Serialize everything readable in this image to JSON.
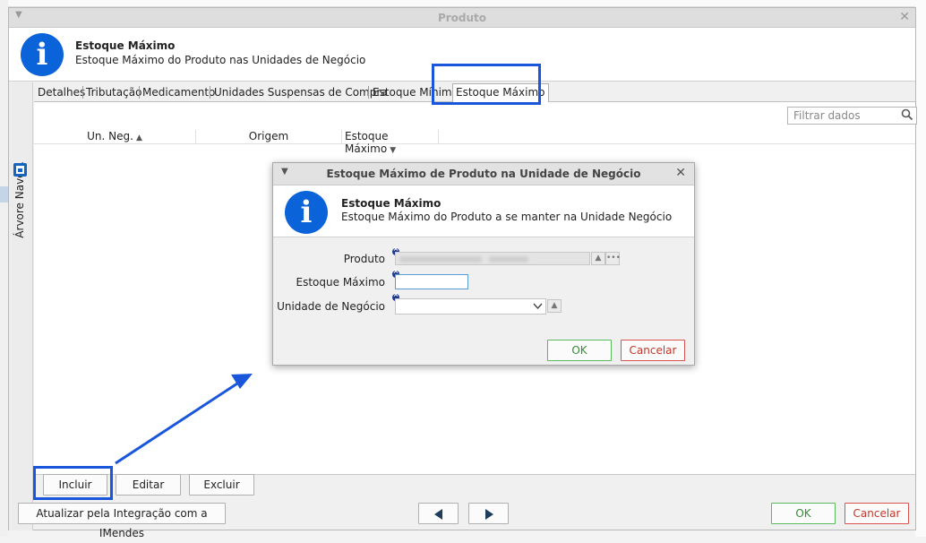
{
  "window": {
    "title": "Produto",
    "header_title": "Estoque Máximo",
    "header_subtitle": "Estoque Máximo do Produto nas Unidades de Negócio"
  },
  "sidebar": {
    "label": "Árvore Naveg."
  },
  "tabs": [
    {
      "label": "Detalhes"
    },
    {
      "label": "Tributação"
    },
    {
      "label": "Medicamento"
    },
    {
      "label": "Unidades Suspensas de Compra"
    },
    {
      "label": "Estoque Mínimo"
    },
    {
      "label": "Estoque Máximo",
      "active": true
    }
  ],
  "filter": {
    "placeholder": "Filtrar dados"
  },
  "table": {
    "columns": [
      {
        "label": "Un. Neg.",
        "sort": "▲"
      },
      {
        "label": "Origem",
        "sort": ""
      },
      {
        "label": "Estoque Máximo",
        "sort": "▼"
      }
    ],
    "rows": []
  },
  "actions": {
    "incluir": "Incluir",
    "editar": "Editar",
    "excluir": "Excluir"
  },
  "footer": {
    "integrate": "Atualizar pela Integração com a IMendes",
    "ok": "OK",
    "cancel": "Cancelar"
  },
  "dialog": {
    "title": "Estoque Máximo de Produto na Unidade de Negócio",
    "header_title": "Estoque Máximo",
    "header_subtitle": "Estoque Máximo do Produto a se manter na Unidade Negócio",
    "fields": {
      "produto_label": "Produto",
      "estoque_label": "Estoque Máximo",
      "estoque_value": "",
      "unidade_label": "Unidade de Negócio",
      "unidade_value": ""
    },
    "ok": "OK",
    "cancel": "Cancelar"
  },
  "colors": {
    "accent": "#0b63d9",
    "highlight": "#1a56db",
    "ok": "#5cb85c",
    "cancel": "#d9534f"
  },
  "icons": {
    "info": "info-icon",
    "search": "search-icon",
    "tree": "tree-nav-icon",
    "prev": "arrow-left-icon",
    "next": "arrow-right-icon",
    "clear": "clear-icon"
  }
}
